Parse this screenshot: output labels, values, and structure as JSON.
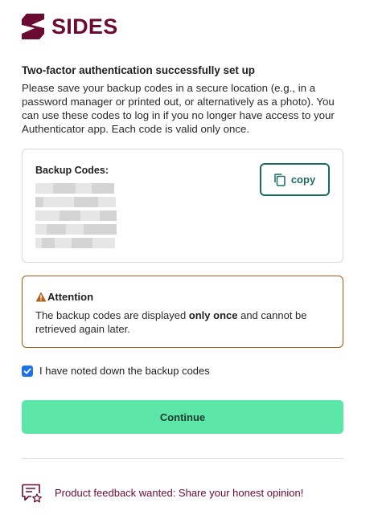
{
  "brand": {
    "name": "SIDES",
    "color": "#6b0a33"
  },
  "content": {
    "title": "Two-factor authentication successfully set up",
    "description": "Please save your backup codes in a secure location (e.g., in a password manager or printed out, or alternatively as a photo). You can use these codes to log in if you no longer have access to your Authenticator app. Each code is valid only once."
  },
  "backup_codes": {
    "label": "Backup Codes:",
    "copy_label": "copy",
    "codes_redacted": 5
  },
  "attention": {
    "title": "Attention",
    "text_before": "The backup codes are displayed ",
    "text_bold": "only once",
    "text_after": " and cannot be retrieved again later.",
    "border_color": "#a35a12"
  },
  "confirm": {
    "label": "I have noted down the backup codes",
    "checked": true
  },
  "actions": {
    "continue_label": "Continue",
    "continue_color": "#5ce6a7"
  },
  "feedback": {
    "text": "Product feedback wanted: Share your honest opinion!"
  },
  "icons": {
    "logo": "sides-logo-icon",
    "copy": "copy-icon",
    "warning": "warning-icon",
    "check": "checkmark-icon",
    "feedback": "feedback-star-icon"
  }
}
